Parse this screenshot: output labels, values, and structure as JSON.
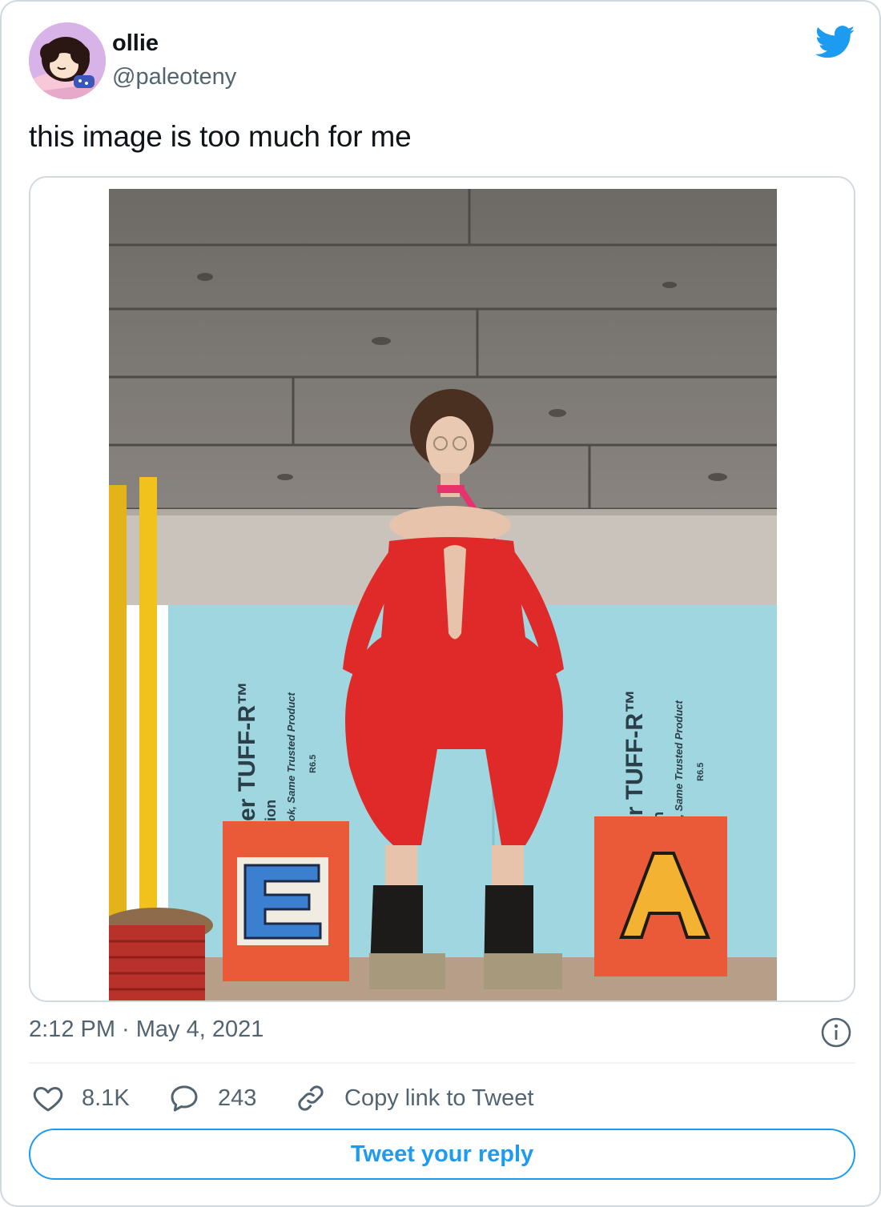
{
  "author": {
    "display_name": "ollie",
    "handle": "@paleoteny",
    "avatar_icon": "cartoon-girl-avatar"
  },
  "tweet": {
    "text": "this image is too much for me",
    "timestamp": "2:12 PM · May 4, 2021"
  },
  "media": {
    "photo_board_texts": {
      "left_brand": "er TUFF-R™",
      "left_sub": "ion",
      "left_tagline": "ok, Same Trusted Product",
      "left_rating": "R6.5",
      "right_brand": "er TUFF-R™",
      "right_sub": "on",
      "right_tagline": "ok, Same Trusted Product",
      "right_rating": "R6.5"
    }
  },
  "actions": {
    "likes": "8.1K",
    "replies": "243",
    "copy_link": "Copy link to Tweet"
  },
  "reply_button": "Tweet your reply",
  "colors": {
    "accent": "#1d9bf0",
    "text_primary": "#0f1419",
    "text_secondary": "#536471",
    "border": "#cfd9de"
  }
}
